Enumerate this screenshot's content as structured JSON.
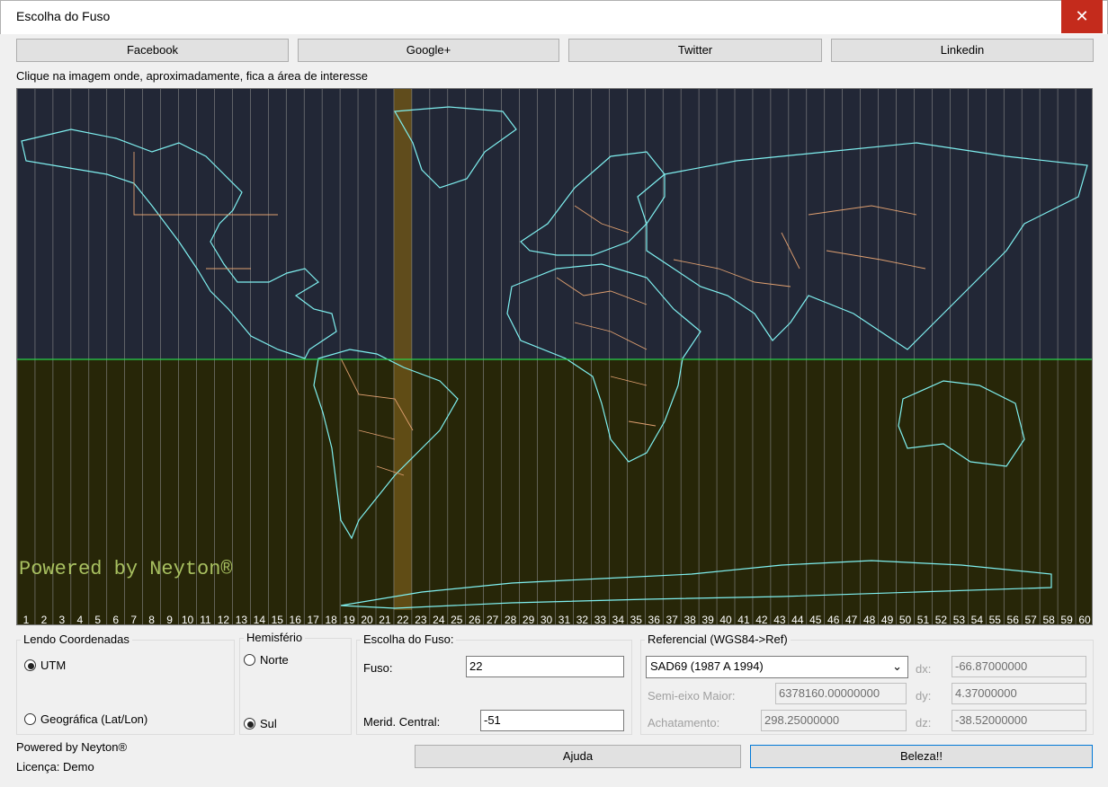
{
  "window": {
    "title": "Escolha do Fuso",
    "close_glyph": "✕"
  },
  "social": [
    "Facebook",
    "Google+",
    "Twitter",
    "Linkedin"
  ],
  "instruction": "Clique na imagem onde, aproximadamente, fica a área de interesse",
  "map": {
    "watermark": "Powered by Neyton®",
    "zone_count": 60,
    "selected_zone": 22,
    "colors": {
      "ocean_north": "#222736",
      "ocean_south": "#272608",
      "highlight": "#6b5317",
      "equator": "#2ad14a",
      "grid": "#8a8a8a",
      "coast": "#7ff0f0",
      "border": "#e0a070",
      "watermark": "#a8c060",
      "label": "#ffffff"
    },
    "zone_labels": [
      "1",
      "2",
      "3",
      "4",
      "5",
      "6",
      "7",
      "8",
      "9",
      "10",
      "11",
      "12",
      "13",
      "14",
      "15",
      "16",
      "17",
      "18",
      "19",
      "20",
      "21",
      "22",
      "23",
      "24",
      "25",
      "26",
      "27",
      "28",
      "29",
      "30",
      "31",
      "32",
      "33",
      "34",
      "35",
      "36",
      "37",
      "38",
      "39",
      "40",
      "41",
      "42",
      "43",
      "44",
      "45",
      "46",
      "47",
      "48",
      "49",
      "50",
      "51",
      "52",
      "53",
      "54",
      "55",
      "56",
      "57",
      "58",
      "59",
      "60"
    ]
  },
  "lendo": {
    "legend": "Lendo Coordenadas",
    "utm": "UTM",
    "geo": "Geográfica (Lat/Lon)",
    "selected": "utm"
  },
  "hemisferio": {
    "legend": "Hemisfério",
    "norte": "Norte",
    "sul": "Sul",
    "selected": "sul"
  },
  "fuso": {
    "legend": "Escolha do Fuso:",
    "fuso_label": "Fuso:",
    "fuso_value": "22",
    "merid_label": "Merid. Central:",
    "merid_value": "-51"
  },
  "referencial": {
    "legend": "Referencial (WGS84->Ref)",
    "datum": "SAD69 (1987 A 1994)",
    "semi_label": "Semi-eixo Maior:",
    "semi_value": "6378160.00000000",
    "achat_label": "Achatamento:",
    "achat_value": "298.25000000",
    "dx_label": "dx:",
    "dx_value": "-66.87000000",
    "dy_label": "dy:",
    "dy_value": "4.37000000",
    "dz_label": "dz:",
    "dz_value": "-38.52000000"
  },
  "footer": {
    "powered": "Powered by Neyton®",
    "license": "Licença: Demo",
    "ajuda": "Ajuda",
    "beleza": "Beleza!!"
  }
}
